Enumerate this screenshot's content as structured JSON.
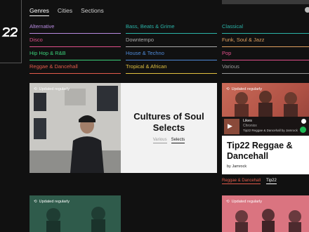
{
  "nav": {
    "tabs": [
      "Genres",
      "Cities",
      "Sections"
    ]
  },
  "genres": [
    {
      "label": "Alternative",
      "color": "#b88be0"
    },
    {
      "label": "Bass, Beats & Grime",
      "color": "#2bb3a8"
    },
    {
      "label": "Classical",
      "color": "#2bb3a8"
    },
    {
      "label": "Disco",
      "color": "#e0508a"
    },
    {
      "label": "Downtempo",
      "color": "#aaaaaa"
    },
    {
      "label": "Funk, Soul & Jazz",
      "color": "#e0a060"
    },
    {
      "label": "Hip Hop & R&B",
      "color": "#3bd07a"
    },
    {
      "label": "House & Techno",
      "color": "#4f8ad8"
    },
    {
      "label": "Pop",
      "color": "#e0508a"
    },
    {
      "label": "Reggae & Dancehall",
      "color": "#e05a4a"
    },
    {
      "label": "Tropical & African",
      "color": "#e0c040"
    },
    {
      "label": "Various",
      "color": "#999999"
    }
  ],
  "feature": {
    "badge": "Updated regularly",
    "title": "Cultures of Soul Selects",
    "links": [
      "Various",
      "Selects"
    ]
  },
  "tip": {
    "badge": "Updated regularly",
    "title": "Tip22 Reggae & Dancehall",
    "by": "by Jamrock",
    "player_track": "Likes",
    "player_artist": "Chronixx",
    "player_playlist": "Tip22 Reggae & Dancehall by Jamrock",
    "links": [
      "Reggae & Dancehall",
      "Tip22"
    ]
  },
  "bottom": {
    "badge1": "Updated regularly",
    "badge2": "Updated regularly"
  }
}
